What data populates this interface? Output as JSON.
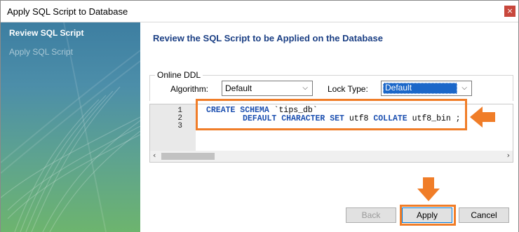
{
  "window": {
    "title": "Apply SQL Script to Database",
    "close_glyph": "×"
  },
  "sidebar": {
    "steps": [
      {
        "label": "Review SQL Script",
        "active": true
      },
      {
        "label": "Apply SQL Script",
        "active": false
      }
    ]
  },
  "main": {
    "heading": "Review the SQL Script to be Applied on the Database",
    "online_ddl": {
      "legend": "Online DDL",
      "algorithm_label": "Algorithm:",
      "algorithm_value": "Default",
      "lock_type_label": "Lock Type:",
      "lock_type_value": "Default"
    },
    "editor": {
      "line_numbers": [
        "1",
        "2",
        "3"
      ],
      "line1": {
        "kw1": "CREATE SCHEMA",
        "ident": " `tips_db`"
      },
      "line2": {
        "kw1": "DEFAULT CHARACTER SET",
        "t1": " utf8 ",
        "kw2": "COLLATE",
        "t2": " utf8_bin ;"
      }
    },
    "buttons": {
      "back": "Back",
      "apply": "Apply",
      "cancel": "Cancel"
    }
  },
  "colors": {
    "highlight": "#f07d28",
    "keyword": "#1b4fb0",
    "heading": "#1b3f84"
  },
  "icons": {
    "dropdown": "chevron-down-icon",
    "scroll_left": "chevron-left-icon",
    "scroll_right": "chevron-right-icon"
  }
}
